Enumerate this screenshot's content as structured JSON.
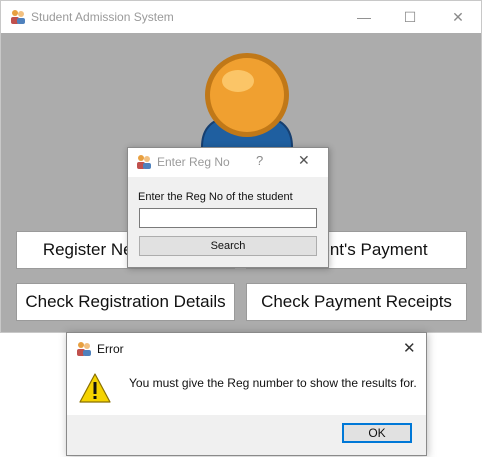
{
  "main_window": {
    "title": "Student Admission System",
    "controls": {
      "minimize": "—",
      "maximize": "☐",
      "close": "✕"
    },
    "buttons": {
      "register": "Register New Student",
      "payment": "Student's Payment",
      "check_registration": "Check Registration Details",
      "check_payment": "Check Payment Receipts"
    }
  },
  "reg_dialog": {
    "title": "Enter Reg No",
    "help": "?",
    "close": "✕",
    "label": "Enter the Reg No of the student",
    "input_value": "",
    "search_label": "Search"
  },
  "error_dialog": {
    "title": "Error",
    "close": "✕",
    "message": "You must give the Reg number to show the results for.",
    "ok_label": "OK"
  },
  "colors": {
    "background_gray": "#acacac",
    "logo_orange": "#f0a030",
    "logo_blue": "#2a6fb0",
    "ok_focus_border": "#0078d7",
    "warning_yellow": "#f5d300"
  },
  "icons": {
    "app": "people-icon",
    "warning": "warning-icon"
  }
}
